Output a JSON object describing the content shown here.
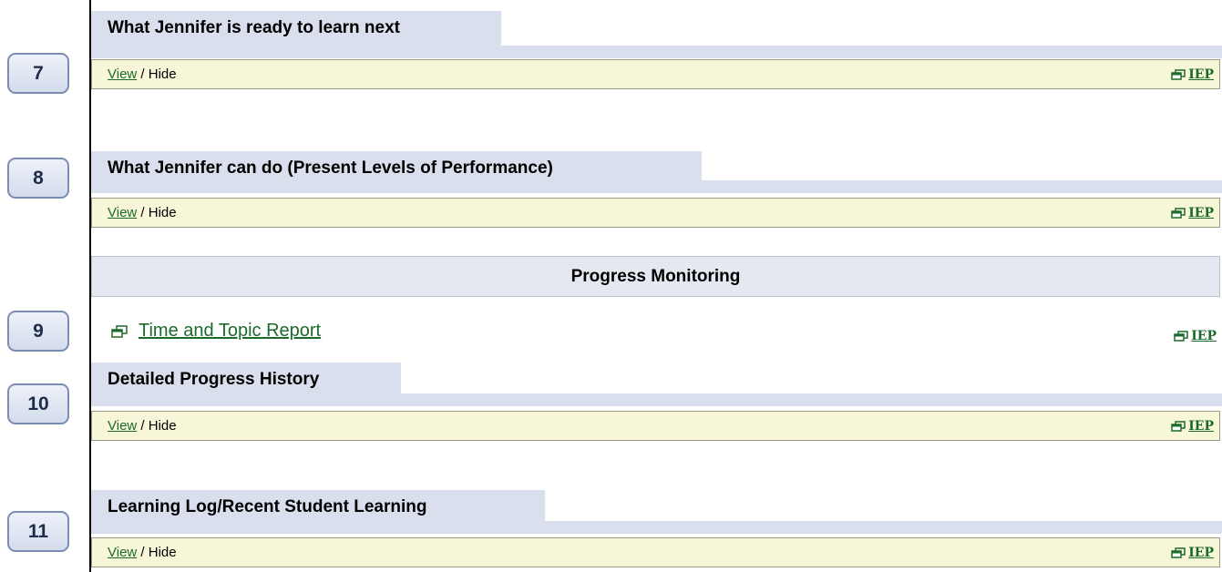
{
  "badges": [
    "7",
    "8",
    "9",
    "10",
    "11"
  ],
  "sections": [
    {
      "title": "What Jennifer is ready to learn next",
      "view_label": "View",
      "separator": " / ",
      "hide_label": "Hide",
      "iep_label": "IEP"
    },
    {
      "title": "What Jennifer can do (Present Levels of Performance)",
      "view_label": "View",
      "separator": " / ",
      "hide_label": "Hide",
      "iep_label": "IEP"
    },
    {
      "title": "Detailed Progress History",
      "view_label": "View",
      "separator": " / ",
      "hide_label": "Hide",
      "iep_label": "IEP"
    },
    {
      "title": "Learning Log/Recent Student Learning",
      "view_label": "View",
      "separator": " / ",
      "hide_label": "Hide",
      "iep_label": "IEP"
    }
  ],
  "progress_monitoring": {
    "header": "Progress Monitoring",
    "report_link": "Time and Topic Report",
    "iep_label": "IEP"
  },
  "colors": {
    "link_green": "#1b6a2a",
    "title_bg": "#d9dfec",
    "view_bar_bg": "#f7f6d9",
    "badge_border": "#7b8db3"
  }
}
